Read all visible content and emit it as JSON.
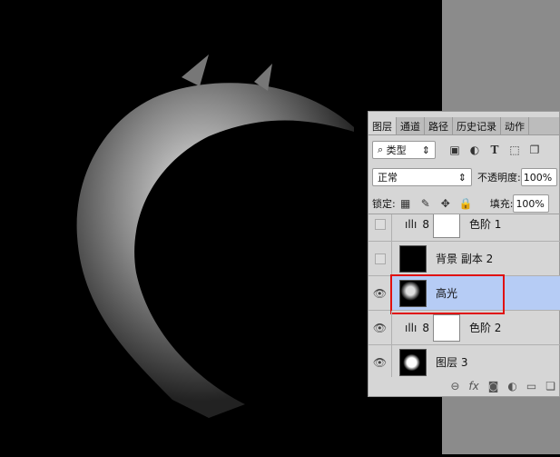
{
  "tabs": [
    "图层",
    "通道",
    "路径",
    "历史记录",
    "动作"
  ],
  "filter": {
    "label": "类型",
    "icons": [
      "image-filter-icon",
      "adjustment-filter-icon",
      "type-filter-icon",
      "shape-filter-icon",
      "smart-object-filter-icon"
    ]
  },
  "blend": {
    "mode": "正常",
    "opacity_label": "不透明度:",
    "opacity": "100%"
  },
  "lock": {
    "label": "锁定:",
    "fill_label": "填充:",
    "fill": "100%"
  },
  "layers": [
    {
      "name": "色阶 1",
      "type": "adjustment",
      "visible": false
    },
    {
      "name": "背景 副本 2",
      "type": "image",
      "visible": false
    },
    {
      "name": "高光",
      "type": "image",
      "visible": true,
      "selected": true
    },
    {
      "name": "色阶 2",
      "type": "adjustment",
      "visible": true
    },
    {
      "name": "图层 3",
      "type": "image",
      "visible": true
    }
  ],
  "colors": {
    "selected": "#b6ccf5",
    "highlight_box": "#e01010"
  }
}
